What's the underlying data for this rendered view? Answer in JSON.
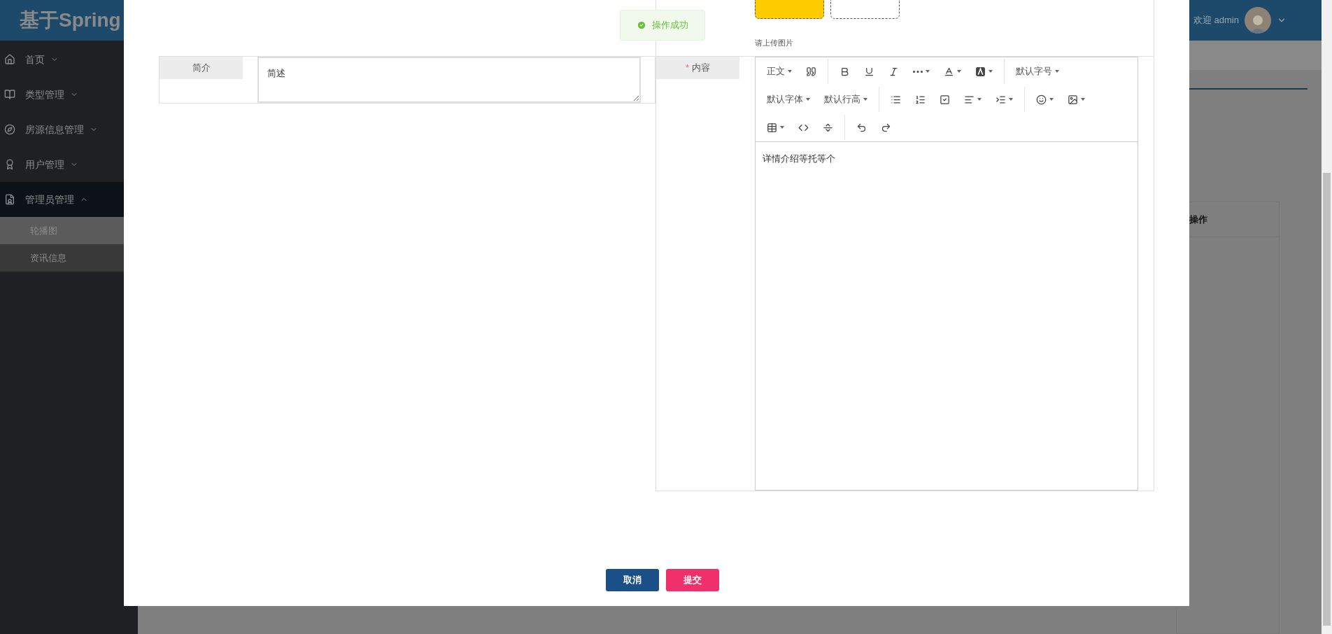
{
  "header": {
    "logo": "基于Spring",
    "greeting": "欢迎 admin"
  },
  "sidebar": {
    "items": [
      {
        "label": "首页",
        "expanded": false
      },
      {
        "label": "类型管理",
        "expanded": false
      },
      {
        "label": "房源信息管理",
        "expanded": false
      },
      {
        "label": "用户管理",
        "expanded": false
      },
      {
        "label": "管理员管理",
        "expanded": true,
        "children": [
          {
            "label": "轮播图",
            "selected": true
          },
          {
            "label": "资讯信息",
            "selected": false
          }
        ]
      }
    ]
  },
  "background_table": {
    "column": "操作"
  },
  "toast": {
    "message": "操作成功"
  },
  "dialog": {
    "summary_field": {
      "label": "简介",
      "value": "简述"
    },
    "upload": {
      "hint": "请上传图片"
    },
    "content_field": {
      "label": "内容",
      "required_mark": "*",
      "body": "详情介绍等托等个",
      "toolbar": [
        [
          [
            {
              "kind": "select",
              "label": "正文"
            },
            {
              "kind": "icon",
              "dropdown": false
            }
          ],
          [
            {
              "kind": "icon",
              "dropdown": false
            },
            {
              "kind": "icon",
              "dropdown": false
            },
            {
              "kind": "icon",
              "dropdown": false
            },
            {
              "kind": "icon",
              "dropdown": true
            },
            {
              "kind": "icon",
              "dropdown": true
            },
            {
              "kind": "icon",
              "dropdown": true
            }
          ],
          [
            {
              "kind": "select",
              "label": "默认字号"
            }
          ]
        ],
        [
          [
            {
              "kind": "select",
              "label": "默认字体"
            },
            {
              "kind": "select",
              "label": "默认行高"
            }
          ],
          [
            {
              "kind": "icon",
              "dropdown": false
            },
            {
              "kind": "icon",
              "dropdown": false
            },
            {
              "kind": "icon",
              "dropdown": false
            },
            {
              "kind": "icon",
              "dropdown": true
            },
            {
              "kind": "icon",
              "dropdown": true
            }
          ],
          [
            {
              "kind": "icon",
              "dropdown": true
            },
            {
              "kind": "icon",
              "dropdown": true
            }
          ]
        ],
        [
          [
            {
              "kind": "icon",
              "dropdown": true
            },
            {
              "kind": "icon",
              "dropdown": false
            },
            {
              "kind": "icon",
              "dropdown": false
            }
          ],
          [
            {
              "kind": "icon",
              "dropdown": false
            },
            {
              "kind": "icon",
              "dropdown": false
            }
          ]
        ]
      ]
    },
    "buttons": [
      {
        "label": "取消",
        "kind": "cancel"
      },
      {
        "label": "提交",
        "kind": "submit"
      }
    ]
  }
}
